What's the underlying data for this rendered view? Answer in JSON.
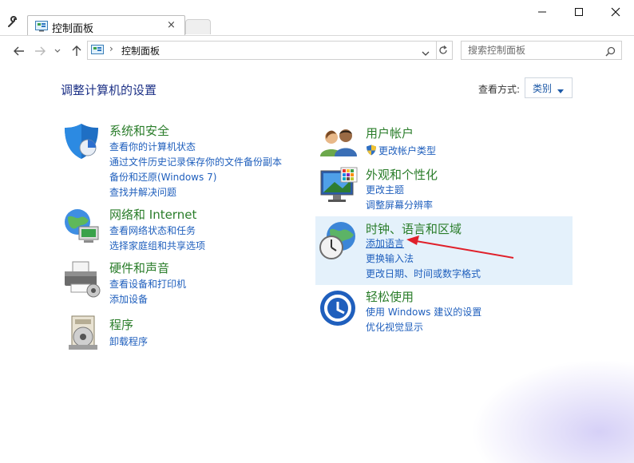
{
  "window": {
    "tab_title": "控制面板",
    "tab_close": "×"
  },
  "nav": {
    "breadcrumb": "控制面板",
    "breadcrumb_sep": "›",
    "search_placeholder": "搜索控制面板"
  },
  "page": {
    "heading": "调整计算机的设置",
    "view_by_label": "查看方式:",
    "view_by_value": "类别"
  },
  "categories": {
    "security": {
      "title": "系统和安全",
      "links": [
        "查看你的计算机状态",
        "通过文件历史记录保存你的文件备份副本",
        "备份和还原(Windows 7)",
        "查找并解决问题"
      ]
    },
    "network": {
      "title": "网络和 Internet",
      "links": [
        "查看网络状态和任务",
        "选择家庭组和共享选项"
      ]
    },
    "hardware": {
      "title": "硬件和声音",
      "links": [
        "查看设备和打印机",
        "添加设备"
      ]
    },
    "programs": {
      "title": "程序",
      "links": [
        "卸载程序"
      ]
    },
    "users": {
      "title": "用户帐户",
      "links": [
        "更改帐户类型"
      ]
    },
    "appearance": {
      "title": "外观和个性化",
      "links": [
        "更改主题",
        "调整屏幕分辨率"
      ]
    },
    "clock": {
      "title": "时钟、语言和区域",
      "links": [
        "添加语言",
        "更换输入法",
        "更改日期、时间或数字格式"
      ]
    },
    "ease": {
      "title": "轻松使用",
      "links": [
        "使用 Windows 建议的设置",
        "优化视觉显示"
      ]
    }
  },
  "colors": {
    "category_title": "#2a7d2a",
    "link": "#1f5fbd",
    "heading": "#1e3287",
    "highlight": "#e4f1fb",
    "annotation_arrow": "#e0202a"
  }
}
